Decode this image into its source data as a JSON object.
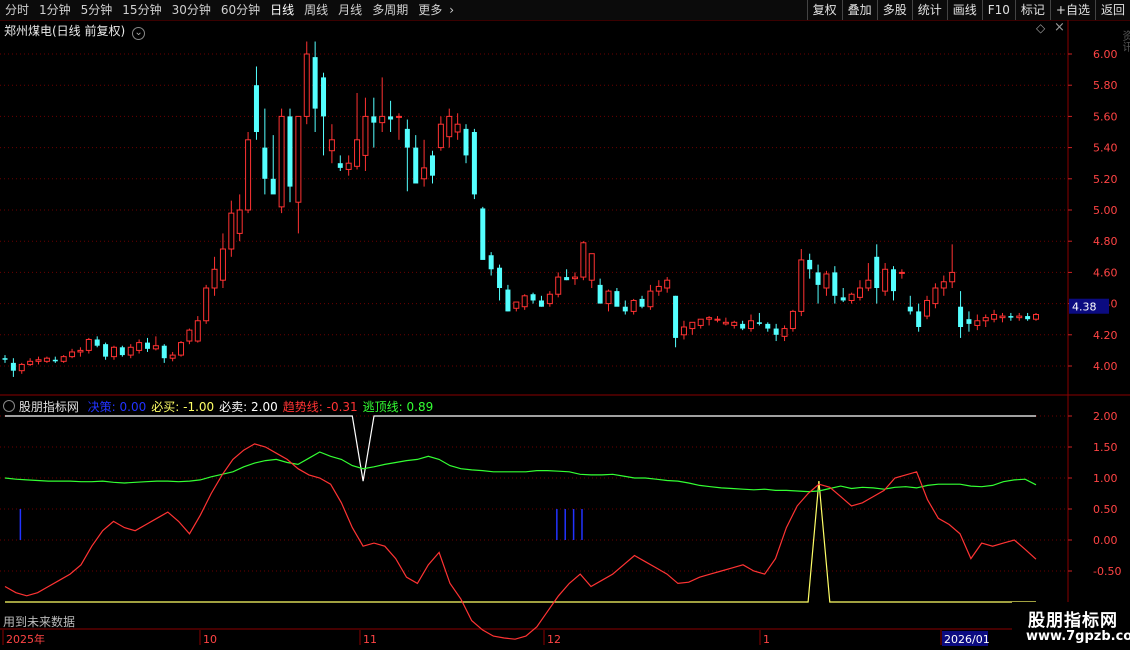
{
  "toolbar": {
    "periods": [
      "分时",
      "1分钟",
      "5分钟",
      "15分钟",
      "30分钟",
      "60分钟",
      "日线",
      "周线",
      "月线",
      "多周期",
      "更多"
    ],
    "active_period": "日线",
    "more_arrow": "›",
    "right_buttons": [
      "复权",
      "叠加",
      "多股",
      "统计",
      "画线",
      "F10",
      "标记",
      "+自选",
      "返回"
    ]
  },
  "main_panel": {
    "stock_title": "郑州煤电(日线 前复权)",
    "dropdown_glyph": "⌄",
    "diamond_glyph": "◇",
    "close_glyph": "×",
    "current_price_tag": "4.38",
    "price_ticks": [
      "6.00",
      "5.80",
      "5.60",
      "5.40",
      "5.20",
      "5.00",
      "4.80",
      "4.60",
      "4.40",
      "4.20",
      "4.00"
    ],
    "right_side_text": "资讯"
  },
  "indicator_panel": {
    "name": "股朋指标网",
    "labels": [
      {
        "text": "决策: 0.00",
        "color": "#2233ff"
      },
      {
        "text": "必买: -1.00",
        "color": "#ffff66"
      },
      {
        "text": "必卖: 2.00",
        "color": "#ffffff"
      },
      {
        "text": "趋势线: -0.31",
        "color": "#ff3333"
      },
      {
        "text": "逃顶线: 0.89",
        "color": "#33ff33"
      }
    ],
    "y_ticks": [
      "2.00",
      "1.50",
      "1.00",
      "0.50",
      "0.00",
      "-0.50"
    ],
    "footer_note": "用到未来数据"
  },
  "x_axis": {
    "labels": [
      {
        "text": "2025年",
        "x": 6
      },
      {
        "text": "10",
        "x": 203
      },
      {
        "text": "11",
        "x": 363
      },
      {
        "text": "12",
        "x": 547
      },
      {
        "text": "1",
        "x": 763
      },
      {
        "text": "2026/01",
        "x": 944
      }
    ]
  },
  "watermark": {
    "title": "股朋指标网",
    "url": "www.7gpzb.com"
  },
  "colors": {
    "up": "#ff3232",
    "down": "#54ffff",
    "trend": "#ff3333",
    "escape": "#33ff33",
    "buy": "#ffff66",
    "sell": "#ffffff",
    "decision": "#2233ff",
    "grid": "#6b0000"
  },
  "chart_data": [
    {
      "type": "candlestick",
      "title": "郑州煤电(日线 前复权)",
      "ylim": [
        3.85,
        6.1
      ],
      "candles": [
        [
          4.05,
          4.07,
          4.02,
          4.04
        ],
        [
          4.02,
          4.05,
          3.93,
          3.97
        ],
        [
          3.97,
          4.02,
          3.95,
          4.01
        ],
        [
          4.01,
          4.05,
          4.0,
          4.03
        ],
        [
          4.03,
          4.06,
          4.01,
          4.04
        ],
        [
          4.03,
          4.06,
          4.02,
          4.05
        ],
        [
          4.04,
          4.06,
          4.02,
          4.03
        ],
        [
          4.03,
          4.07,
          4.02,
          4.06
        ],
        [
          4.06,
          4.11,
          4.05,
          4.09
        ],
        [
          4.09,
          4.12,
          4.06,
          4.1
        ],
        [
          4.1,
          4.18,
          4.08,
          4.17
        ],
        [
          4.17,
          4.19,
          4.12,
          4.13
        ],
        [
          4.14,
          4.15,
          4.04,
          4.06
        ],
        [
          4.06,
          4.13,
          4.04,
          4.12
        ],
        [
          4.12,
          4.13,
          4.06,
          4.07
        ],
        [
          4.07,
          4.14,
          4.05,
          4.12
        ],
        [
          4.1,
          4.17,
          4.08,
          4.15
        ],
        [
          4.15,
          4.18,
          4.09,
          4.11
        ],
        [
          4.11,
          4.19,
          4.1,
          4.13
        ],
        [
          4.13,
          4.14,
          4.02,
          4.05
        ],
        [
          4.05,
          4.09,
          4.03,
          4.07
        ],
        [
          4.07,
          4.16,
          4.06,
          4.15
        ],
        [
          4.16,
          4.24,
          4.14,
          4.23
        ],
        [
          4.16,
          4.32,
          4.15,
          4.29
        ],
        [
          4.29,
          4.52,
          4.27,
          4.5
        ],
        [
          4.5,
          4.7,
          4.45,
          4.62
        ],
        [
          4.55,
          4.85,
          4.5,
          4.75
        ],
        [
          4.75,
          5.06,
          4.7,
          4.98
        ],
        [
          4.85,
          5.1,
          4.8,
          5.0
        ],
        [
          5.0,
          5.5,
          4.98,
          5.45
        ],
        [
          5.8,
          5.92,
          5.45,
          5.5
        ],
        [
          5.4,
          5.65,
          5.1,
          5.2
        ],
        [
          5.2,
          5.48,
          5.15,
          5.1
        ],
        [
          5.02,
          5.65,
          4.98,
          5.6
        ],
        [
          5.6,
          5.65,
          5.05,
          5.15
        ],
        [
          5.05,
          5.6,
          4.85,
          5.6
        ],
        [
          5.6,
          6.08,
          5.55,
          6.0
        ],
        [
          5.98,
          6.08,
          5.5,
          5.65
        ],
        [
          5.85,
          5.88,
          5.35,
          5.6
        ],
        [
          5.38,
          5.55,
          5.3,
          5.45
        ],
        [
          5.3,
          5.35,
          5.25,
          5.27
        ],
        [
          5.26,
          5.35,
          5.22,
          5.3
        ],
        [
          5.28,
          5.75,
          5.26,
          5.45
        ],
        [
          5.35,
          5.72,
          5.25,
          5.6
        ],
        [
          5.6,
          5.72,
          5.4,
          5.56
        ],
        [
          5.56,
          5.85,
          5.5,
          5.6
        ],
        [
          5.6,
          5.7,
          5.5,
          5.58
        ],
        [
          5.6,
          5.62,
          5.45,
          5.6
        ],
        [
          5.52,
          5.58,
          5.12,
          5.4
        ],
        [
          5.4,
          5.48,
          5.2,
          5.17
        ],
        [
          5.2,
          5.45,
          5.15,
          5.27
        ],
        [
          5.35,
          5.38,
          5.17,
          5.22
        ],
        [
          5.4,
          5.6,
          5.38,
          5.55
        ],
        [
          5.47,
          5.65,
          5.4,
          5.6
        ],
        [
          5.5,
          5.62,
          5.45,
          5.55
        ],
        [
          5.52,
          5.55,
          5.3,
          5.35
        ],
        [
          5.5,
          5.52,
          5.07,
          5.1
        ],
        [
          5.01,
          5.02,
          4.79,
          4.68
        ],
        [
          4.71,
          4.73,
          4.58,
          4.62
        ],
        [
          4.63,
          4.65,
          4.42,
          4.5
        ],
        [
          4.49,
          4.52,
          4.35,
          4.35
        ],
        [
          4.37,
          4.41,
          4.35,
          4.41
        ],
        [
          4.38,
          4.46,
          4.36,
          4.45
        ],
        [
          4.46,
          4.47,
          4.4,
          4.42
        ],
        [
          4.42,
          4.45,
          4.38,
          4.38
        ],
        [
          4.4,
          4.48,
          4.38,
          4.46
        ],
        [
          4.46,
          4.6,
          4.44,
          4.57
        ],
        [
          4.57,
          4.62,
          4.55,
          4.55
        ],
        [
          4.56,
          4.6,
          4.52,
          4.57
        ],
        [
          4.57,
          4.8,
          4.55,
          4.79
        ],
        [
          4.55,
          4.65,
          4.5,
          4.72
        ],
        [
          4.52,
          4.56,
          4.43,
          4.4
        ],
        [
          4.4,
          4.49,
          4.35,
          4.48
        ],
        [
          4.48,
          4.5,
          4.4,
          4.38
        ],
        [
          4.38,
          4.42,
          4.33,
          4.35
        ],
        [
          4.35,
          4.43,
          4.33,
          4.42
        ],
        [
          4.43,
          4.45,
          4.37,
          4.38
        ],
        [
          4.38,
          4.52,
          4.36,
          4.48
        ],
        [
          4.48,
          4.55,
          4.45,
          4.51
        ],
        [
          4.5,
          4.57,
          4.47,
          4.55
        ],
        [
          4.45,
          4.45,
          4.12,
          4.18
        ],
        [
          4.2,
          4.29,
          4.17,
          4.25
        ],
        [
          4.24,
          4.26,
          4.2,
          4.28
        ],
        [
          4.26,
          4.28,
          4.24,
          4.3
        ],
        [
          4.3,
          4.32,
          4.26,
          4.31
        ],
        [
          4.3,
          4.32,
          4.28,
          4.3
        ],
        [
          4.27,
          4.31,
          4.26,
          4.28
        ],
        [
          4.26,
          4.29,
          4.24,
          4.28
        ],
        [
          4.27,
          4.29,
          4.23,
          4.24
        ],
        [
          4.24,
          4.33,
          4.22,
          4.29
        ],
        [
          4.28,
          4.34,
          4.26,
          4.27
        ],
        [
          4.27,
          4.28,
          4.22,
          4.24
        ],
        [
          4.24,
          4.27,
          4.16,
          4.2
        ],
        [
          4.19,
          4.26,
          4.16,
          4.24
        ],
        [
          4.24,
          4.36,
          4.22,
          4.35
        ],
        [
          4.35,
          4.75,
          4.32,
          4.68
        ],
        [
          4.68,
          4.72,
          4.56,
          4.62
        ],
        [
          4.6,
          4.65,
          4.4,
          4.52
        ],
        [
          4.5,
          4.61,
          4.45,
          4.59
        ],
        [
          4.6,
          4.64,
          4.4,
          4.45
        ],
        [
          4.44,
          4.5,
          4.41,
          4.42
        ],
        [
          4.42,
          4.47,
          4.4,
          4.46
        ],
        [
          4.44,
          4.55,
          4.42,
          4.5
        ],
        [
          4.5,
          4.66,
          4.48,
          4.55
        ],
        [
          4.7,
          4.78,
          4.4,
          4.5
        ],
        [
          4.48,
          4.66,
          4.45,
          4.62
        ],
        [
          4.62,
          4.64,
          4.42,
          4.48
        ],
        [
          4.6,
          4.62,
          4.56,
          4.6
        ],
        [
          4.38,
          4.45,
          4.33,
          4.35
        ],
        [
          4.35,
          4.4,
          4.22,
          4.25
        ],
        [
          4.32,
          4.45,
          4.3,
          4.42
        ],
        [
          4.4,
          4.53,
          4.37,
          4.5
        ],
        [
          4.5,
          4.58,
          4.45,
          4.54
        ],
        [
          4.54,
          4.78,
          4.5,
          4.6
        ],
        [
          4.38,
          4.48,
          4.18,
          4.25
        ],
        [
          4.3,
          4.35,
          4.22,
          4.27
        ],
        [
          4.26,
          4.33,
          4.23,
          4.29
        ],
        [
          4.29,
          4.33,
          4.25,
          4.31
        ],
        [
          4.3,
          4.36,
          4.28,
          4.33
        ],
        [
          4.31,
          4.34,
          4.28,
          4.32
        ],
        [
          4.32,
          4.34,
          4.29,
          4.31
        ],
        [
          4.31,
          4.34,
          4.29,
          4.32
        ],
        [
          4.32,
          4.34,
          4.29,
          4.3
        ],
        [
          4.3,
          4.34,
          4.29,
          4.33
        ]
      ]
    },
    {
      "type": "line",
      "title": "股朋指标网",
      "ylim": [
        -0.95,
        2.2
      ],
      "series": [
        {
          "name": "趋势线",
          "values": [
            -0.75,
            -0.85,
            -0.9,
            -0.85,
            -0.75,
            -0.65,
            -0.55,
            -0.4,
            -0.1,
            0.15,
            0.3,
            0.2,
            0.15,
            0.25,
            0.35,
            0.45,
            0.3,
            0.1,
            0.4,
            0.75,
            1.05,
            1.3,
            1.45,
            1.55,
            1.5,
            1.4,
            1.3,
            1.15,
            1.05,
            1.0,
            0.9,
            0.6,
            0.2,
            -0.1,
            -0.05,
            -0.1,
            -0.3,
            -0.6,
            -0.7,
            -0.4,
            -0.2,
            -0.7,
            -0.95,
            -1.3,
            -1.45,
            -1.55,
            -1.58,
            -1.6,
            -1.55,
            -1.4,
            -1.15,
            -0.9,
            -0.7,
            -0.55,
            -0.75,
            -0.65,
            -0.55,
            -0.4,
            -0.25,
            -0.35,
            -0.45,
            -0.55,
            -0.7,
            -0.68,
            -0.6,
            -0.55,
            -0.5,
            -0.45,
            -0.4,
            -0.5,
            -0.55,
            -0.3,
            0.2,
            0.55,
            0.75,
            0.9,
            0.85,
            0.7,
            0.55,
            0.6,
            0.7,
            0.8,
            1.0,
            1.05,
            1.1,
            0.65,
            0.35,
            0.25,
            0.1,
            -0.3,
            -0.05,
            -0.1,
            -0.05,
            0.0,
            -0.15,
            -0.31
          ]
        },
        {
          "name": "逃顶线",
          "values": [
            1.0,
            0.98,
            0.97,
            0.96,
            0.95,
            0.95,
            0.95,
            0.94,
            0.94,
            0.95,
            0.93,
            0.92,
            0.93,
            0.94,
            0.95,
            0.95,
            0.94,
            0.95,
            0.97,
            1.02,
            1.06,
            1.1,
            1.18,
            1.24,
            1.28,
            1.3,
            1.25,
            1.22,
            1.32,
            1.42,
            1.35,
            1.3,
            1.2,
            1.15,
            1.18,
            1.22,
            1.25,
            1.28,
            1.3,
            1.35,
            1.3,
            1.2,
            1.15,
            1.13,
            1.12,
            1.1,
            1.1,
            1.1,
            1.1,
            1.12,
            1.12,
            1.11,
            1.1,
            1.06,
            1.05,
            1.05,
            1.06,
            1.03,
            1.0,
            1.0,
            0.98,
            0.96,
            0.95,
            0.92,
            0.88,
            0.86,
            0.84,
            0.83,
            0.82,
            0.81,
            0.82,
            0.8,
            0.8,
            0.79,
            0.78,
            0.79,
            0.83,
            0.87,
            0.83,
            0.85,
            0.84,
            0.82,
            0.85,
            0.86,
            0.84,
            0.88,
            0.9,
            0.9,
            0.9,
            0.87,
            0.86,
            0.88,
            0.94,
            0.97,
            0.98,
            0.89
          ]
        },
        {
          "name": "必卖",
          "values": [
            2.0,
            2.0,
            2.0,
            2.0,
            2.0,
            2.0,
            2.0,
            2.0,
            2.0,
            2.0,
            2.0,
            2.0,
            2.0,
            2.0,
            2.0,
            2.0,
            2.0,
            2.0,
            2.0,
            2.0,
            2.0,
            2.0,
            2.0,
            2.0,
            2.0,
            2.0,
            2.0,
            2.0,
            2.0,
            2.0,
            2.0,
            2.0,
            2.0,
            0.95,
            2.0,
            2.0,
            2.0,
            2.0,
            2.0,
            2.0,
            2.0,
            2.0,
            2.0,
            2.0,
            2.0,
            2.0,
            2.0,
            2.0,
            2.0,
            2.0,
            2.0,
            2.0,
            2.0,
            2.0,
            2.0,
            2.0,
            2.0,
            2.0,
            2.0,
            2.0,
            2.0,
            2.0,
            2.0,
            2.0,
            2.0,
            2.0,
            2.0,
            2.0,
            2.0,
            2.0,
            2.0,
            2.0,
            2.0,
            2.0,
            2.0,
            2.0,
            2.0,
            2.0,
            2.0,
            2.0,
            2.0,
            2.0,
            2.0,
            2.0,
            2.0,
            2.0,
            2.0,
            2.0,
            2.0,
            2.0,
            2.0,
            2.0,
            2.0,
            2.0,
            2.0,
            2.0
          ]
        },
        {
          "name": "必买",
          "values": [
            -1.0,
            -1.0,
            -1.0,
            -1.0,
            -1.0,
            -1.0,
            -1.0,
            -1.0,
            -1.0,
            -1.0,
            -1.0,
            -1.0,
            -1.0,
            -1.0,
            -1.0,
            -1.0,
            -1.0,
            -1.0,
            -1.0,
            -1.0,
            -1.0,
            -1.0,
            -1.0,
            -1.0,
            -1.0,
            -1.0,
            -1.0,
            -1.0,
            -1.0,
            -1.0,
            -1.0,
            -1.0,
            -1.0,
            -1.0,
            -1.0,
            -1.0,
            -1.0,
            -1.0,
            -1.0,
            -1.0,
            -1.0,
            -1.0,
            -1.0,
            -1.0,
            -1.0,
            -1.0,
            -1.0,
            -1.0,
            -1.0,
            -1.0,
            -1.0,
            -1.0,
            -1.0,
            -1.0,
            -1.0,
            -1.0,
            -1.0,
            -1.0,
            -1.0,
            -1.0,
            -1.0,
            -1.0,
            -1.0,
            -1.0,
            -1.0,
            -1.0,
            -1.0,
            -1.0,
            -1.0,
            -1.0,
            -1.0,
            -1.0,
            -1.0,
            -1.0,
            -1.0,
            0.95,
            -1.0,
            -1.0,
            -1.0,
            -1.0,
            -1.0,
            -1.0,
            -1.0,
            -1.0,
            -1.0,
            -1.0,
            -1.0,
            -1.0,
            -1.0,
            -1.0,
            -1.0,
            -1.0,
            -1.0,
            -1.0,
            -1.0,
            -1.0
          ]
        }
      ],
      "decision_bars_index": [
        1,
        65,
        66,
        67,
        68
      ]
    }
  ]
}
